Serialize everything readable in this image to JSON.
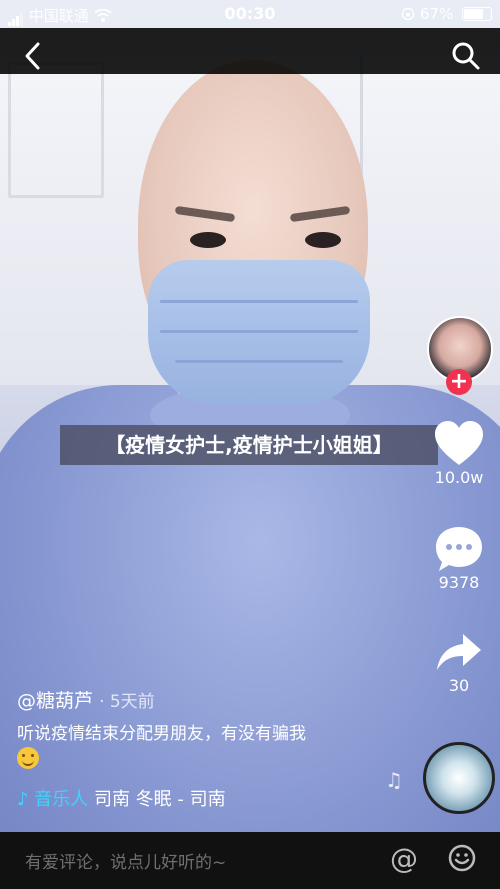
{
  "status_bar": {
    "carrier": "中国联通",
    "time": "00:30",
    "battery": "67%"
  },
  "nav": {
    "back_icon": "chevron-left-icon",
    "search_icon": "search-icon"
  },
  "video": {
    "title": "【疫情女护士,疫情护士小姐姐】"
  },
  "side_actions": {
    "follow_label": "+",
    "likes": "10.0w",
    "comments": "9378",
    "shares": "30"
  },
  "post": {
    "username": "@糖葫芦",
    "time_ago": "· 5天前",
    "description": "听说疫情结束分配男朋友，有没有骗我",
    "music_tag": "♪ 音乐人",
    "music_title": "司南    冬眠 - 司南"
  },
  "comment_bar": {
    "placeholder": "有爱评论，说点儿好听的~",
    "mention_symbol": "@"
  },
  "colors": {
    "follow_red": "#f0314f",
    "music_blue": "#3fd2ff"
  }
}
